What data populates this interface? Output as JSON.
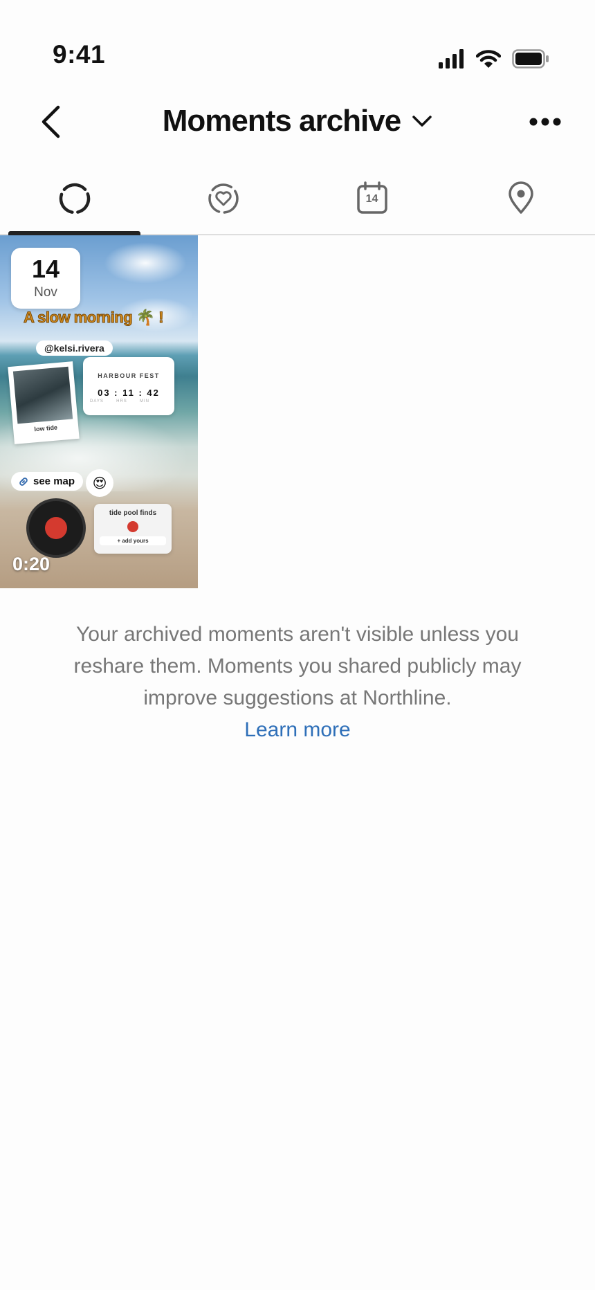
{
  "status_bar": {
    "time": "9:41",
    "icons": [
      "cellular-signal-icon",
      "wifi-icon",
      "battery-icon"
    ]
  },
  "header": {
    "back_icon": "chevron-left-icon",
    "title": "Moments archive",
    "title_dropdown_icon": "chevron-down-icon",
    "more_icon": "more-horizontal-icon"
  },
  "tabs": [
    {
      "name": "moments",
      "icon": "dashed-circle-icon",
      "selected": true
    },
    {
      "name": "highlights",
      "icon": "heart-circle-icon",
      "selected": false
    },
    {
      "name": "calendar",
      "icon": "calendar-icon",
      "label": "14",
      "selected": false
    },
    {
      "name": "map",
      "icon": "location-pin-icon",
      "selected": false
    }
  ],
  "archive_items": [
    {
      "date_day": "14",
      "date_month": "Nov",
      "caption": "A slow morning 🌴 !",
      "mention": "@kelsi.rivera",
      "polaroid_label": "low tide",
      "countdown_title": "HARBOUR FEST",
      "countdown_time": "03 : 11 : 42",
      "countdown_units": [
        "DAYS",
        "HRS",
        "MIN"
      ],
      "link_label": "see map",
      "emoji": "😍",
      "poll_title": "tide pool finds",
      "poll_add": "+ add yours",
      "duration": "0:20"
    }
  ],
  "info": {
    "text": "Your archived moments aren't visible unless you reshare them. Moments you shared publicly may improve suggestions at Northline.",
    "link": "Learn more"
  },
  "colors": {
    "link": "#2e6fb8",
    "text_secondary": "#777777",
    "indicator": "#222222",
    "record": "#d43a2f"
  }
}
